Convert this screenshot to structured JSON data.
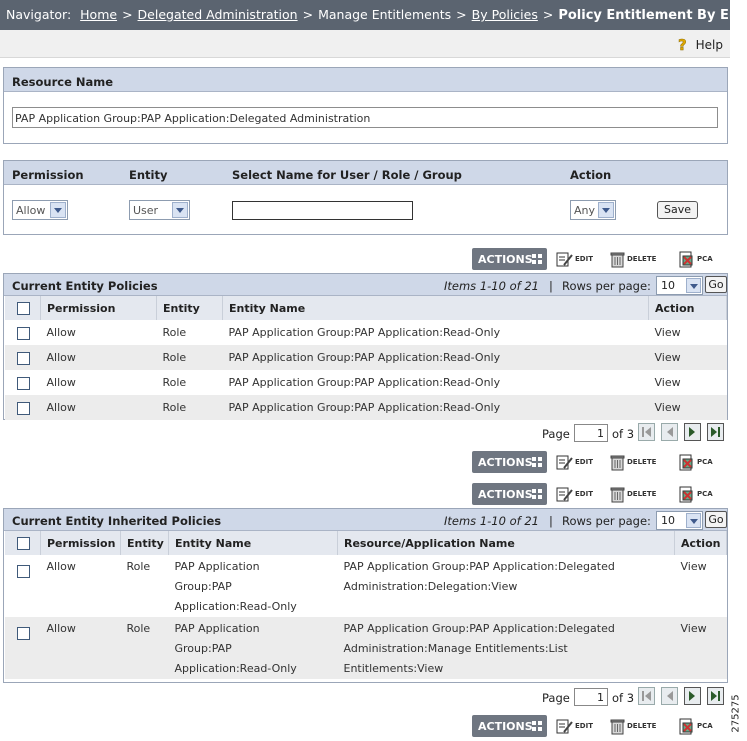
{
  "breadcrumb": {
    "prefix": "Navigator:",
    "links": [
      "Home",
      "Delegated Administration"
    ],
    "plain": "Manage Entitlements",
    "link3": "By Policies",
    "current": "Policy Entitlement By Entity",
    "sep": ">"
  },
  "help": {
    "label": "Help"
  },
  "resource": {
    "header": "Resource Name",
    "value": "PAP Application Group:PAP Application:Delegated Administration"
  },
  "form": {
    "headers": {
      "permission": "Permission",
      "entity": "Entity",
      "select_name": "Select Name for User / Role / Group",
      "action": "Action"
    },
    "permission_value": "Allow",
    "entity_value": "User",
    "action_value": "Any",
    "name_value": "",
    "save_label": "Save"
  },
  "toolbar": {
    "actions": "ACTIONS",
    "edit": "EDIT",
    "delete": "DELETE",
    "pca": "PCA"
  },
  "current": {
    "title": "Current Entity Policies",
    "items": "Items 1-10 of 21",
    "bar": "|",
    "rows_per_page_label": "Rows per page:",
    "rows_per_page": "10",
    "go": "Go",
    "columns": [
      "Permission",
      "Entity",
      "Entity Name",
      "Action"
    ],
    "rows": [
      [
        "Allow",
        "Role",
        "PAP Application Group:PAP Application:Read-Only",
        "View"
      ],
      [
        "Allow",
        "Role",
        "PAP Application Group:PAP Application:Read-Only",
        "View"
      ],
      [
        "Allow",
        "Role",
        "PAP Application Group:PAP Application:Read-Only",
        "View"
      ],
      [
        "Allow",
        "Role",
        "PAP Application Group:PAP Application:Read-Only",
        "View"
      ]
    ],
    "pager": {
      "page_label": "Page",
      "page": "1",
      "of": "of 3"
    }
  },
  "inherited": {
    "title": "Current Entity Inherited Policies",
    "items": "Items 1-10 of 21",
    "bar": "|",
    "rows_per_page_label": "Rows per page:",
    "rows_per_page": "10",
    "go": "Go",
    "columns": [
      "Permission",
      "Entity",
      "Entity Name",
      "Resource/Application Name",
      "Action"
    ],
    "rows": [
      {
        "permission": "Allow",
        "entity": "Role",
        "name": [
          "PAP Application",
          "Group:PAP",
          "Application:Read-Only"
        ],
        "resource": [
          "PAP Application Group:PAP Application:Delegated",
          "Administration:Delegation:View"
        ],
        "action": "View"
      },
      {
        "permission": "Allow",
        "entity": "Role",
        "name": [
          "PAP Application",
          "Group:PAP",
          "Application:Read-Only"
        ],
        "resource": [
          "PAP Application Group:PAP Application:Delegated",
          "Administration:Manage Entitlements:List",
          "Entitlements:View"
        ],
        "action": "View"
      }
    ],
    "pager": {
      "page_label": "Page",
      "page": "1",
      "of": "of 3"
    }
  },
  "figure_code": "275275"
}
